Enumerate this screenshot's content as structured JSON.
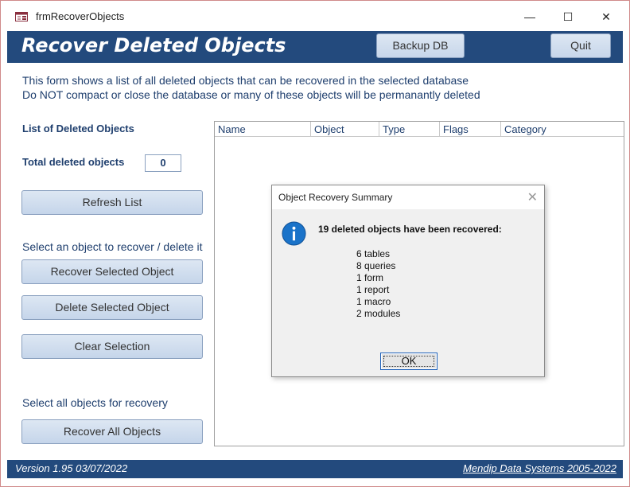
{
  "window": {
    "title": "frmRecoverObjects",
    "min_glyph": "—",
    "max_glyph": "☐",
    "close_glyph": "✕"
  },
  "header": {
    "title": "Recover Deleted Objects",
    "backup_label": "Backup DB",
    "quit_label": "Quit"
  },
  "intro": {
    "line1": "This form shows a list of all deleted objects that can be recovered in the selected database",
    "line2": "Do NOT compact or close the database or many of these objects will be permanantly deleted"
  },
  "sidebar": {
    "list_label": "List of Deleted Objects",
    "total_label": "Total deleted objects",
    "total_value": "0",
    "refresh_label": "Refresh List",
    "select_text": "Select an object to recover / delete it",
    "recover_selected_label": "Recover Selected Object",
    "delete_selected_label": "Delete Selected Object",
    "clear_label": "Clear Selection",
    "select_all_text": "Select all objects for recovery",
    "recover_all_label": "Recover All Objects"
  },
  "listbox": {
    "columns": [
      "Name",
      "Object",
      "Type",
      "Flags",
      "Category"
    ]
  },
  "dialog": {
    "title": "Object Recovery Summary",
    "close_glyph": "✕",
    "message": "19 deleted objects have been recovered:",
    "lines": [
      "6 tables",
      "8 queries",
      "1 form",
      "1 report",
      "1 macro",
      "2 modules"
    ],
    "ok_label": "OK"
  },
  "footer": {
    "version": "Version 1.95  03/07/2022",
    "company": "Mendip Data Systems 2005-2022"
  },
  "colors": {
    "header_bg": "#234a7d",
    "text_blue": "#1f3f6e",
    "info_blue": "#1a73c9"
  }
}
